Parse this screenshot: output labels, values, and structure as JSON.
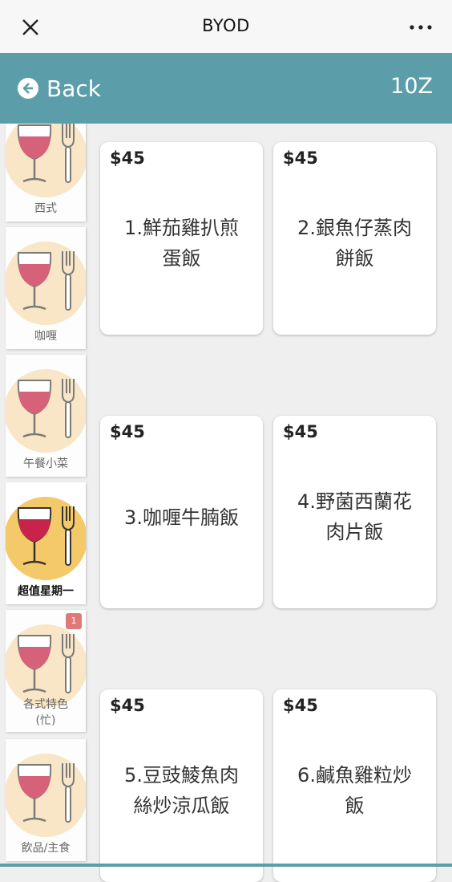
{
  "window": {
    "title": "BYOD"
  },
  "nav": {
    "back_label": "Back",
    "table_number": "10Z"
  },
  "categories": [
    {
      "name": "西式",
      "active": false
    },
    {
      "name": "咖喱",
      "active": false
    },
    {
      "name": "午餐小菜",
      "active": false
    },
    {
      "name": "超值星期一",
      "active": true
    },
    {
      "name": "各式特色",
      "name2": "(忙)",
      "badge": "1",
      "active": false
    },
    {
      "name": "飲品/主食",
      "active": false
    }
  ],
  "items": [
    {
      "price": "$45",
      "line1": "1.鮮茄雞扒煎",
      "line2": "蛋飯"
    },
    {
      "price": "$45",
      "line1": "2.銀魚仔蒸肉",
      "line2": "餅飯"
    },
    {
      "price": "$45",
      "line1": "3.咖喱牛腩飯",
      "line2": ""
    },
    {
      "price": "$45",
      "line1": "4.野菌西蘭花",
      "line2": "肉片飯"
    },
    {
      "price": "$45",
      "line1": "5.豆豉鯪魚肉",
      "line2": "絲炒涼瓜飯"
    },
    {
      "price": "$45",
      "line1": "6.鹹魚雞粒炒",
      "line2": "飯"
    }
  ],
  "icons": {
    "close": "close-icon",
    "more": "more-icon",
    "back": "back-arrow-icon",
    "glass": "wine-glass-icon",
    "fork": "fork-icon"
  },
  "colors": {
    "accent": "#5b9ea9",
    "active_bubble": "#f4c96a",
    "bubble": "#f8e6c6",
    "wine": "#d6627a",
    "badge": "#e07a78"
  }
}
